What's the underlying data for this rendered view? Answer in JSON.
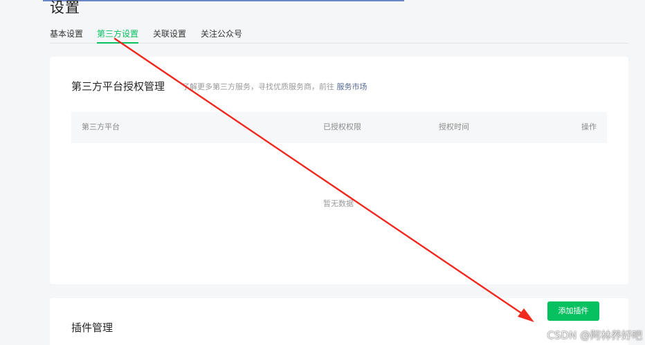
{
  "header": {
    "title": "设置"
  },
  "tabs": [
    {
      "label": "基本设置",
      "active": false
    },
    {
      "label": "第三方设置",
      "active": true
    },
    {
      "label": "关联设置",
      "active": false
    },
    {
      "label": "关注公众号",
      "active": false
    }
  ],
  "auth_section": {
    "title": "第三方平台授权管理",
    "desc_text": "了解更多第三方服务，寻找优质服务商，前往",
    "market_link": "服务市场",
    "columns": [
      "第三方平台",
      "已授权权限",
      "授权时间",
      "操作"
    ],
    "empty_text": "暂无数据"
  },
  "plugin_section": {
    "title": "插件管理",
    "add_button_label": "添加插件"
  },
  "watermark": "CSDN @阿林养好吧",
  "colors": {
    "accent": "#07c160",
    "link": "#576b95",
    "annotation_arrow": "#f0281e"
  },
  "icons": [
    "red-arrow-annotation"
  ]
}
